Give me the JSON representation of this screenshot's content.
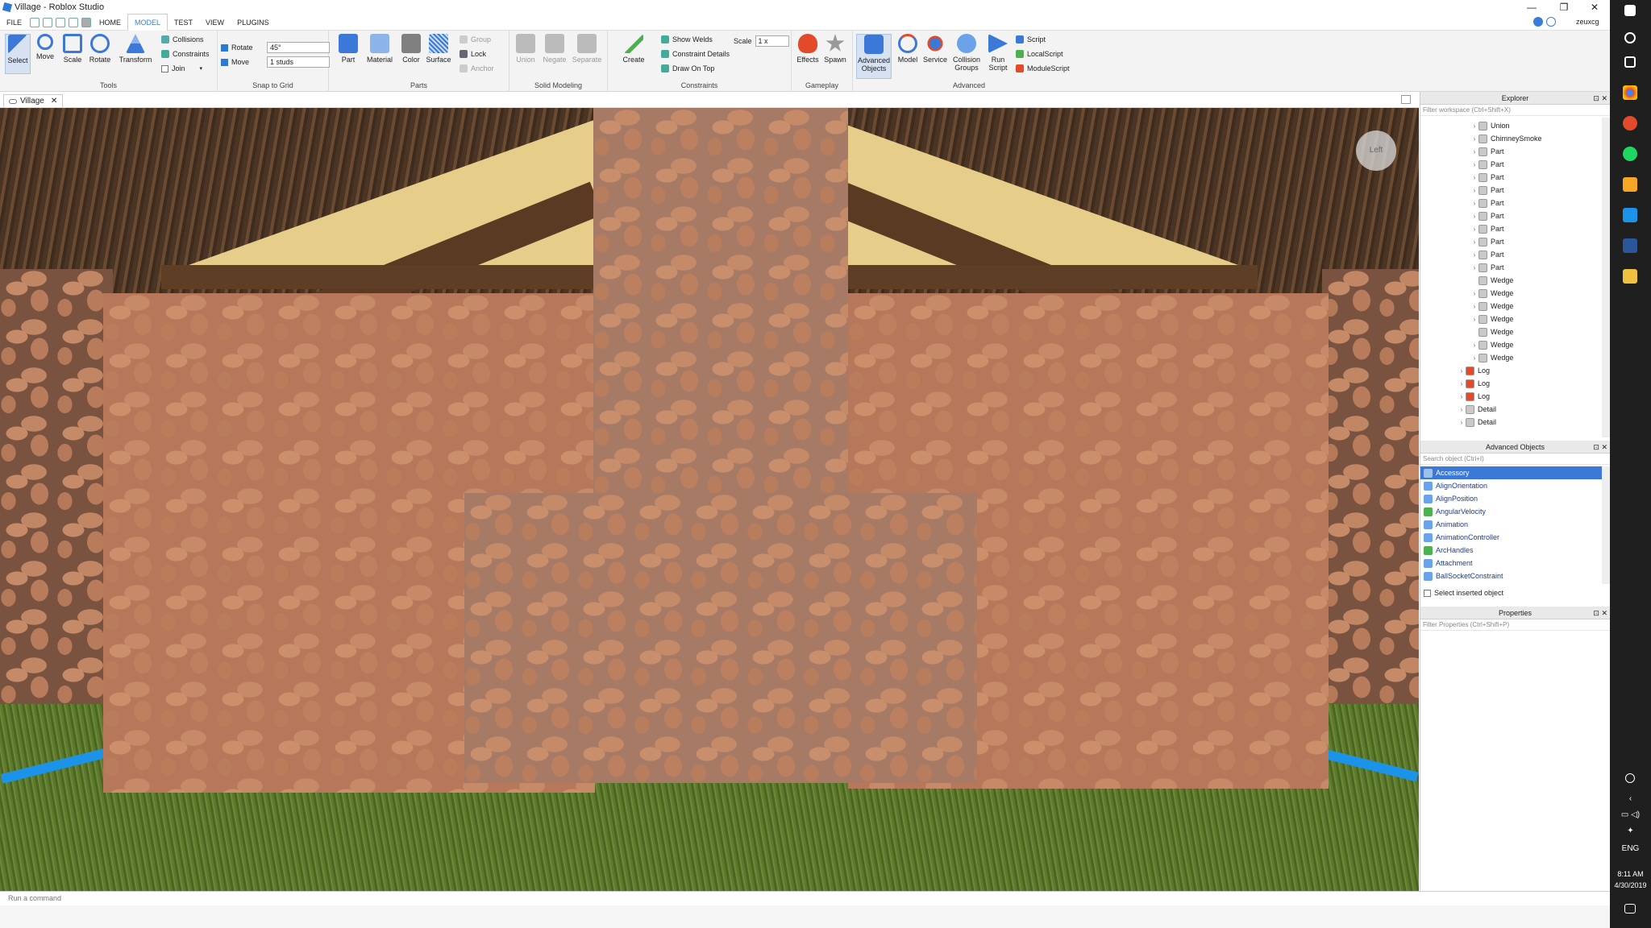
{
  "window": {
    "title": "Village - Roblox Studio",
    "user": "zeuxcg",
    "controls": [
      "—",
      "❐",
      "✕"
    ]
  },
  "menu": {
    "file": "FILE",
    "tabs": [
      "HOME",
      "MODEL",
      "TEST",
      "VIEW",
      "PLUGINS"
    ],
    "active_tab": "MODEL"
  },
  "ribbon": {
    "tools": {
      "label": "Tools",
      "select": "Select",
      "move": "Move",
      "scale": "Scale",
      "rotate": "Rotate",
      "transform": "Transform",
      "collisions": "Collisions",
      "constraints": "Constraints",
      "join": "Join"
    },
    "snap": {
      "label": "Snap to Grid",
      "rotate_label": "Rotate",
      "rotate_value": "45°",
      "move_label": "Move",
      "move_value": "1 studs"
    },
    "parts": {
      "label": "Parts",
      "part": "Part",
      "material": "Material",
      "color": "Color",
      "surface": "Surface",
      "group": "Group",
      "lock": "Lock",
      "anchor": "Anchor"
    },
    "solid": {
      "label": "Solid Modeling",
      "union": "Union",
      "negate": "Negate",
      "separate": "Separate"
    },
    "constraints": {
      "label": "Constraints",
      "create": "Create",
      "show_welds": "Show Welds",
      "constraint_details": "Constraint Details",
      "draw_on_top": "Draw On Top",
      "scale_label": "Scale",
      "scale_value": "1 x"
    },
    "gameplay": {
      "label": "Gameplay",
      "effects": "Effects",
      "spawn": "Spawn"
    },
    "advanced": {
      "label": "Advanced",
      "advanced_objects_1": "Advanced",
      "advanced_objects_2": "Objects",
      "model": "Model",
      "service": "Service",
      "collision_1": "Collision",
      "collision_2": "Groups",
      "run_1": "Run",
      "run_2": "Script",
      "script": "Script",
      "localscript": "LocalScript",
      "modulescript": "ModuleScript"
    }
  },
  "document_tab": {
    "label": "Village"
  },
  "viewport": {
    "view_cube_label": "Left"
  },
  "explorer": {
    "title": "Explorer",
    "filter_placeholder": "Filter workspace (Ctrl+Shift+X)",
    "items": [
      {
        "label": "Union",
        "icon": "union-icon",
        "indent": 2,
        "arrow": true
      },
      {
        "label": "ChimneySmoke",
        "icon": "part-icon",
        "indent": 2,
        "arrow": true
      },
      {
        "label": "Part",
        "icon": "part-icon",
        "indent": 2,
        "arrow": true
      },
      {
        "label": "Part",
        "icon": "part-icon",
        "indent": 2,
        "arrow": true
      },
      {
        "label": "Part",
        "icon": "part-icon",
        "indent": 2,
        "arrow": true
      },
      {
        "label": "Part",
        "icon": "part-icon",
        "indent": 2,
        "arrow": true
      },
      {
        "label": "Part",
        "icon": "part-icon",
        "indent": 2,
        "arrow": true
      },
      {
        "label": "Part",
        "icon": "part-icon",
        "indent": 2,
        "arrow": true
      },
      {
        "label": "Part",
        "icon": "part-icon",
        "indent": 2,
        "arrow": true
      },
      {
        "label": "Part",
        "icon": "part-icon",
        "indent": 2,
        "arrow": true
      },
      {
        "label": "Part",
        "icon": "part-icon",
        "indent": 2,
        "arrow": true
      },
      {
        "label": "Part",
        "icon": "part-icon",
        "indent": 2,
        "arrow": true
      },
      {
        "label": "Wedge",
        "icon": "wedge-icon",
        "indent": 2,
        "arrow": false
      },
      {
        "label": "Wedge",
        "icon": "wedge-icon",
        "indent": 2,
        "arrow": true
      },
      {
        "label": "Wedge",
        "icon": "wedge-icon",
        "indent": 2,
        "arrow": true
      },
      {
        "label": "Wedge",
        "icon": "wedge-icon",
        "indent": 2,
        "arrow": true
      },
      {
        "label": "Wedge",
        "icon": "wedge-icon",
        "indent": 2,
        "arrow": false
      },
      {
        "label": "Wedge",
        "icon": "wedge-icon",
        "indent": 2,
        "arrow": true
      },
      {
        "label": "Wedge",
        "icon": "wedge-icon",
        "indent": 2,
        "arrow": true
      },
      {
        "label": "Log",
        "icon": "model-icon",
        "indent": 1,
        "arrow": true
      },
      {
        "label": "Log",
        "icon": "model-icon",
        "indent": 1,
        "arrow": true
      },
      {
        "label": "Log",
        "icon": "model-icon",
        "indent": 1,
        "arrow": true
      },
      {
        "label": "Detail",
        "icon": "part-icon",
        "indent": 1,
        "arrow": true
      },
      {
        "label": "Detail",
        "icon": "part-icon",
        "indent": 1,
        "arrow": true
      }
    ]
  },
  "advanced_objects": {
    "title": "Advanced Objects",
    "search_placeholder": "Search object (Ctrl+I)",
    "items": [
      "Accessory",
      "AlignOrientation",
      "AlignPosition",
      "AngularVelocity",
      "Animation",
      "AnimationController",
      "ArcHandles",
      "Attachment",
      "BallSocketConstraint"
    ],
    "selected": "Accessory",
    "select_inserted": "Select inserted object"
  },
  "properties": {
    "title": "Properties",
    "filter_placeholder": "Filter Properties (Ctrl+Shift+P)"
  },
  "command_bar": {
    "placeholder": "Run a command"
  },
  "taskbar": {
    "time": "8:11 AM",
    "date": "4/30/2019",
    "language": "ENG"
  },
  "colors": {
    "accent": "#3b78d8",
    "ribbon_bg": "#f3f3f3",
    "taskbar_bg": "#1f1f1f",
    "stone": "#b6775a",
    "roof": "#5a3a22",
    "grass": "#5d7a2c",
    "plaster": "#e8cf8e"
  }
}
